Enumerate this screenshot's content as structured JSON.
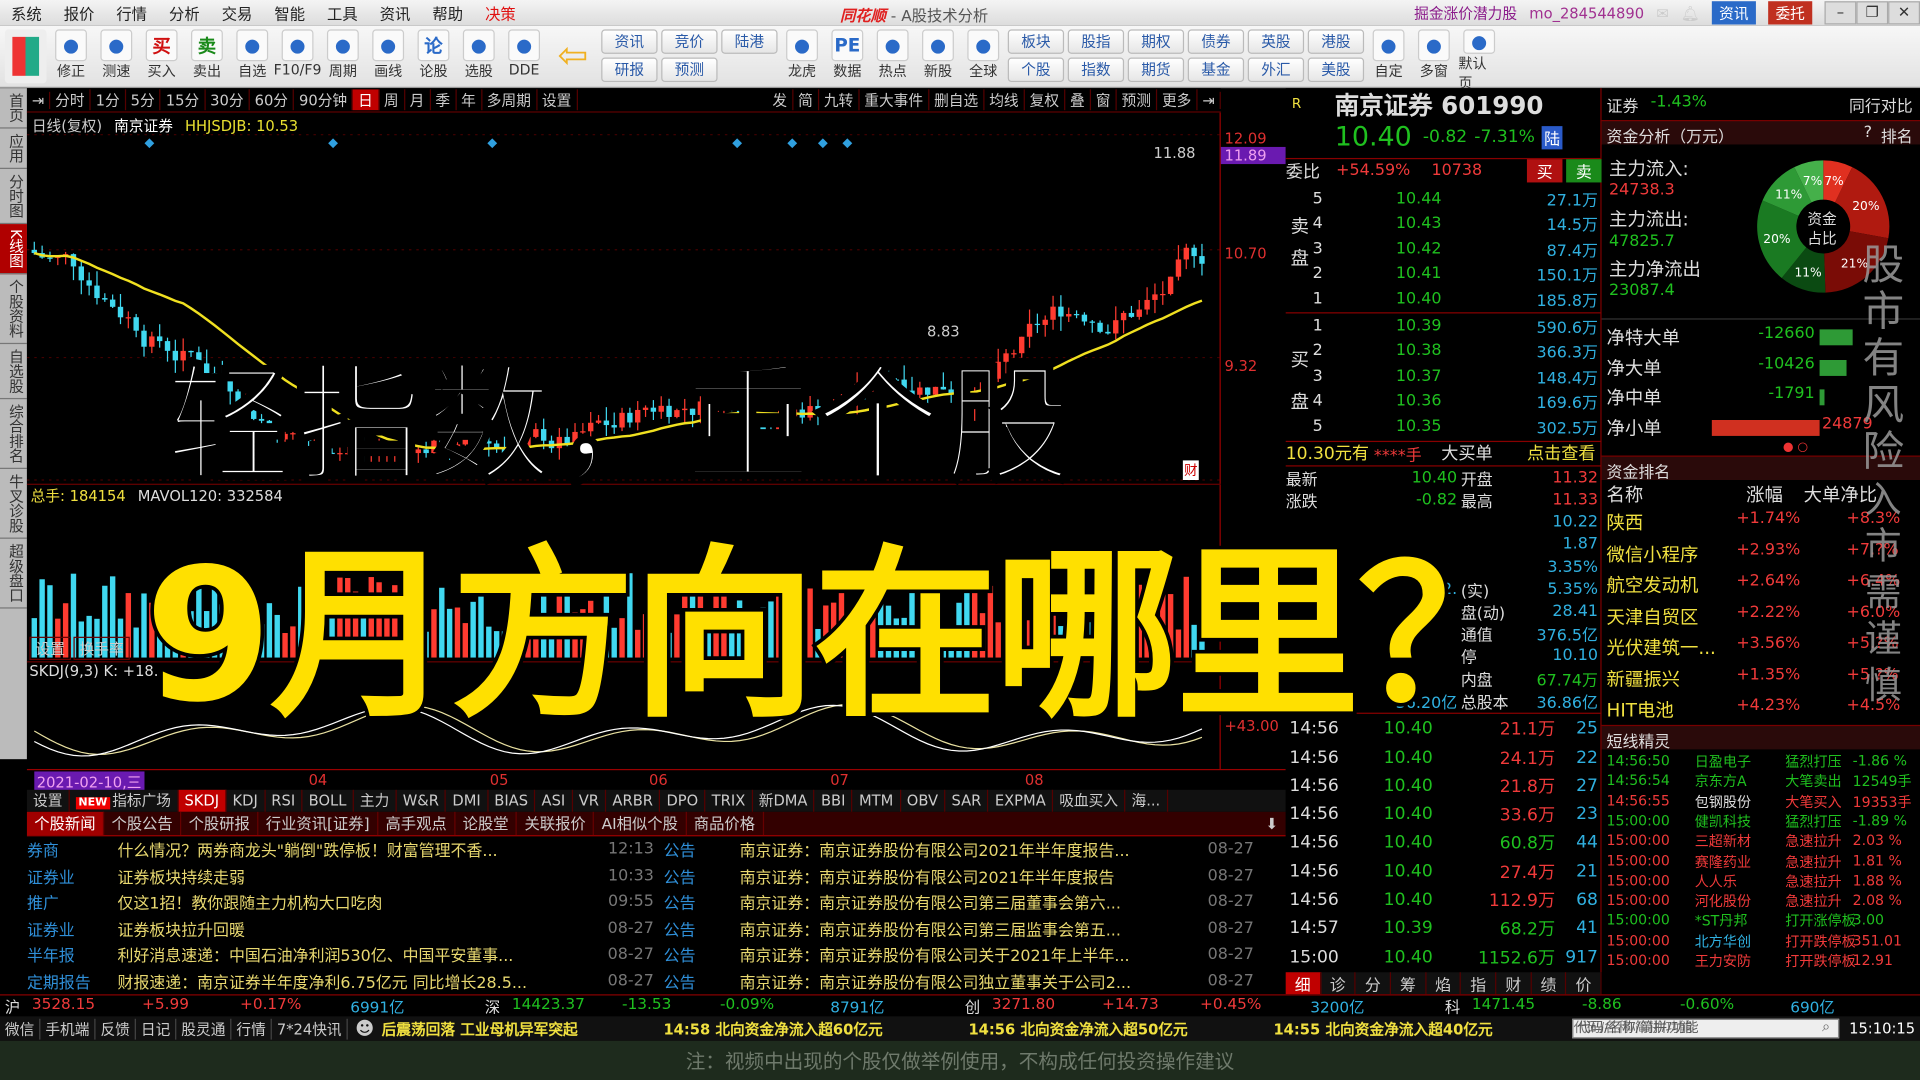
{
  "menu": [
    "系统",
    "报价",
    "行情",
    "分析",
    "交易",
    "智能",
    "工具",
    "资讯",
    "帮助",
    "决策"
  ],
  "app_title": {
    "brand": "同花顺",
    "subtitle": " - A股技术分析"
  },
  "top_right": {
    "promo": "掘金涨价潜力股",
    "user": "mo_284544890",
    "zixun": "资讯",
    "weituo": "委托"
  },
  "toolbar": {
    "tools": [
      {
        "label": "修正",
        "icon": "arrow-up-down-icon"
      },
      {
        "label": "测速",
        "icon": "clock-icon"
      },
      {
        "label": "买入",
        "icon": "buy-icon",
        "glyph": "买"
      },
      {
        "label": "卖出",
        "icon": "sell-icon",
        "glyph": "卖"
      },
      {
        "label": "自选",
        "icon": "star-folder-icon"
      },
      {
        "label": "F10/F9",
        "icon": "f10-icon"
      },
      {
        "label": "周期",
        "icon": "period-icon"
      },
      {
        "label": "画线",
        "icon": "pen-icon"
      },
      {
        "label": "论股",
        "icon": "lun-icon",
        "glyph": "论"
      },
      {
        "label": "选股",
        "icon": "select-stock-icon"
      },
      {
        "label": "DDE",
        "icon": "dde-icon"
      }
    ],
    "pairs1": [
      [
        "资讯",
        "研报"
      ],
      [
        "竞价",
        "预测"
      ],
      [
        "陆港",
        ""
      ]
    ],
    "tools2": [
      {
        "label": "龙虎",
        "icon": "dragon-icon"
      },
      {
        "label": "数据",
        "icon": "pe-icon",
        "glyph": "PE"
      },
      {
        "label": "热点",
        "icon": "hot-icon"
      },
      {
        "label": "新股",
        "icon": "ipo-icon"
      },
      {
        "label": "全球",
        "icon": "globe-icon"
      }
    ],
    "pairs2": [
      [
        "板块",
        "个股"
      ],
      [
        "股指",
        "指数"
      ],
      [
        "期权",
        "期货"
      ],
      [
        "债券",
        "基金"
      ],
      [
        "英股",
        "外汇"
      ],
      [
        "港股",
        "美股"
      ]
    ],
    "tools3": [
      {
        "label": "自定",
        "icon": "custom-icon"
      },
      {
        "label": "多窗",
        "icon": "multiwindow-icon"
      },
      {
        "label": "默认页",
        "icon": "default-page-icon"
      }
    ]
  },
  "left_tabs": [
    "首页",
    "应用",
    "分时图",
    "K线图",
    "个股资料",
    "自选股",
    "综合排名",
    "牛叉诊股",
    "超级盘口"
  ],
  "period_bar": [
    "分时",
    "1分",
    "5分",
    "15分",
    "30分",
    "60分",
    "90分钟",
    "日",
    "周",
    "月",
    "季",
    "年",
    "多周期",
    "设置"
  ],
  "period_active": "日",
  "chart_tools": [
    "发",
    "简",
    "九转",
    "重大事件",
    "删自选",
    "均线",
    "复权",
    "叠",
    "窗",
    "预测",
    "更多"
  ],
  "chart": {
    "header_type": "日线(复权)",
    "header_name": "南京证券",
    "indicator": "HHJSDJB: 10.53",
    "high_label": "11.88",
    "low_label": "8.83",
    "vol_header": "总手: 184154",
    "mavol": "MAVOL120: 332584",
    "skdj_header": "SKDJ(9,3) K: +18.",
    "vol_buttons": [
      "设置",
      "换手率"
    ],
    "fin_marker": "财"
  },
  "price_axis": [
    "12.09",
    "11.89",
    "10.70",
    "9.32",
    "+43.00"
  ],
  "date_axis": {
    "current": "2021-02-10,三",
    "months": [
      "04",
      "05",
      "06",
      "07",
      "08"
    ]
  },
  "indicator_tabs": [
    "设置",
    "指标广场",
    "SKDJ",
    "KDJ",
    "RSI",
    "BOLL",
    "主力",
    "W&R",
    "DMI",
    "BIAS",
    "ASI",
    "VR",
    "ARBR",
    "DPO",
    "TRIX",
    "新DMA",
    "BBI",
    "MTM",
    "OBV",
    "SAR",
    "EXPMA",
    "吸血买入",
    "海..."
  ],
  "news_tabs": [
    "个股新闻",
    "个股公告",
    "个股研报",
    "行业资讯[证券]",
    "高手观点",
    "论股堂",
    "关联报价",
    "AI相似个股",
    "商品价格"
  ],
  "news": [
    {
      "tag": "券商",
      "title": "什么情况？两券商龙头\"躺倒\"跌停板！财富管理不香...",
      "time": "12:13",
      "tag2": "公告",
      "title2": "南京证券：南京证券股份有限公司2021年半年度报告...",
      "date2": "08-27"
    },
    {
      "tag": "证券业",
      "title": "证券板块持续走弱",
      "time": "10:33",
      "tag2": "公告",
      "title2": "南京证券：南京证券股份有限公司2021年半年度报告",
      "date2": "08-27"
    },
    {
      "tag": "推广",
      "title": "仅这1招！教你跟随主力机构大口吃肉",
      "time": "09:55",
      "tag2": "公告",
      "title2": "南京证券：南京证券股份有限公司第三届董事会第六...",
      "date2": "08-27"
    },
    {
      "tag": "证券业",
      "title": "证券板块拉升回暖",
      "time": "08-27",
      "tag2": "公告",
      "title2": "南京证券：南京证券股份有限公司第三届监事会第五...",
      "date2": "08-27"
    },
    {
      "tag": "半年报",
      "title": "利好消息速递：中国石油净利润530亿、中国平安董事...",
      "time": "08-27",
      "tag2": "公告",
      "title2": "南京证券：南京证券股份有限公司关于2021年上半年...",
      "date2": "08-27"
    },
    {
      "tag": "定期报告",
      "title": "财报速递：南京证券半年度净利6.75亿元 同比增长28.5...",
      "time": "08-27",
      "tag2": "公告",
      "title2": "南京证券：南京证券股份有限公司独立董事关于公司2...",
      "date2": "08-27"
    }
  ],
  "quote": {
    "r": "R",
    "name": "南京证券 601990",
    "price": "10.40",
    "change": "-0.82",
    "pct": "-7.31%",
    "market": "陆",
    "weibi_label": "委比",
    "weibi": "+54.59%",
    "weicha": "10738",
    "buy": "买",
    "sell": "卖",
    "sell_label": "卖盘",
    "buy_label": "买盘",
    "asks": [
      [
        "5",
        "10.44",
        "27.1万"
      ],
      [
        "4",
        "10.43",
        "14.5万"
      ],
      [
        "3",
        "10.42",
        "87.4万"
      ],
      [
        "2",
        "10.41",
        "150.1万"
      ],
      [
        "1",
        "10.40",
        "185.8万"
      ]
    ],
    "bids": [
      [
        "1",
        "10.39",
        "590.6万"
      ],
      [
        "2",
        "10.38",
        "366.3万"
      ],
      [
        "3",
        "10.37",
        "148.4万"
      ],
      [
        "4",
        "10.36",
        "169.6万"
      ],
      [
        "5",
        "10.35",
        "302.5万"
      ]
    ],
    "bigorder": {
      "price": "10.30元有",
      "qty": "****手",
      "label": "大买单",
      "link": "点击查看"
    },
    "stats": [
      [
        "最新",
        "10.40",
        "开盘",
        "11.32"
      ],
      [
        "涨跌",
        "-0.82",
        "最高",
        "11.33"
      ],
      [
        "",
        "",
        "",
        "10.22"
      ],
      [
        "",
        "",
        "",
        "1.87"
      ],
      [
        "",
        "",
        "",
        "3.35%"
      ],
      [
        "",
        "2.",
        "(实)",
        "5.35%"
      ],
      [
        "",
        "",
        "盘(动)",
        "28.41"
      ],
      [
        "",
        "",
        "通值",
        "376.5亿"
      ],
      [
        "",
        "",
        "停",
        "10.10"
      ],
      [
        "",
        "",
        "内盘",
        "67.74万"
      ],
      [
        "流通股",
        "36.20亿",
        "总股本",
        "36.86亿"
      ]
    ],
    "ticks": [
      [
        "14:56",
        "10.40",
        "21.1万",
        "25",
        "red"
      ],
      [
        "14:56",
        "10.40",
        "24.1万",
        "22",
        "red"
      ],
      [
        "14:56",
        "10.40",
        "21.8万",
        "27",
        "red"
      ],
      [
        "14:56",
        "10.40",
        "33.6万",
        "23",
        "red"
      ],
      [
        "14:56",
        "10.40",
        "60.8万",
        "44",
        "green"
      ],
      [
        "14:56",
        "10.40",
        "27.4万",
        "21",
        "red"
      ],
      [
        "14:56",
        "10.40",
        "112.9万",
        "68",
        "red"
      ],
      [
        "14:57",
        "10.39",
        "68.2万",
        "41",
        "green"
      ],
      [
        "15:00",
        "10.40",
        "1152.6万",
        "917",
        "green"
      ]
    ],
    "bottom_tabs": [
      "细",
      "诊",
      "分",
      "筹",
      "焰",
      "指",
      "财",
      "绩",
      "价"
    ]
  },
  "fund": {
    "sector": "证券",
    "sector_pct": "-1.43%",
    "compare": "同行对比",
    "title": "资金分析（万元）",
    "help": "?",
    "rank": "排名",
    "inflow_label": "主力流入:",
    "inflow": "24738.3",
    "outflow_label": "主力流出:",
    "outflow": "47825.7",
    "net_label": "主力净流出",
    "net": "23087.4",
    "donut_center": [
      "资金",
      "占比"
    ],
    "donut": [
      {
        "pct": 7,
        "color": "#e03020"
      },
      {
        "pct": 20,
        "color": "#b01a10"
      },
      {
        "pct": 21,
        "color": "#7a0c06"
      },
      {
        "pct": 11,
        "color": "#0b4a12"
      },
      {
        "pct": 20,
        "color": "#1a7a22"
      },
      {
        "pct": 11,
        "color": "#2e9a36"
      },
      {
        "pct": 7,
        "color": "#45b04a"
      }
    ],
    "flows": [
      {
        "label": "净特大单",
        "value": "-12660",
        "v": -12660
      },
      {
        "label": "净大单",
        "value": "-10426",
        "v": -10426
      },
      {
        "label": "净中单",
        "value": "-1791",
        "v": -1791
      },
      {
        "label": "净小单",
        "value": "24879",
        "v": 24879
      }
    ],
    "rank_title": "资金排名",
    "rank_headers": [
      "名称",
      "涨幅",
      "大单净比"
    ],
    "ranks": [
      [
        "陕西",
        "+1.74%",
        "+8.3%"
      ],
      [
        "微信小程序",
        "+2.93%",
        "+7.?%"
      ],
      [
        "航空发动机",
        "+2.64%",
        "+6.4%"
      ],
      [
        "天津自贸区",
        "+2.22%",
        "+6.0%"
      ],
      [
        "光伏建筑一...",
        "+3.56%",
        "+5.?%"
      ],
      [
        "新疆振兴",
        "+1.35%",
        "+5.?%"
      ],
      [
        "HIT电池",
        "+4.23%",
        "+4.5%"
      ]
    ],
    "sprite_title": "短线精灵",
    "sprites": [
      [
        "14:56:50",
        "日盈电子",
        "猛烈打压",
        "-1.86 %",
        "green"
      ],
      [
        "14:56:54",
        "京东方A",
        "大笔卖出",
        "12549手",
        "green"
      ],
      [
        "14:56:55",
        "包钢股份",
        "大笔买入",
        "19353手",
        "red"
      ],
      [
        "15:00:00",
        "健凯科技",
        "猛烈打压",
        "-1.89 %",
        "green"
      ],
      [
        "15:00:00",
        "三超新材",
        "急速拉升",
        "2.03 %",
        "red"
      ],
      [
        "15:00:00",
        "赛隆药业",
        "急速拉升",
        "1.81 %",
        "red"
      ],
      [
        "15:00:00",
        "人人乐",
        "急速拉升",
        "1.88 %",
        "red"
      ],
      [
        "15:00:00",
        "河化股份",
        "急速拉升",
        "2.08 %",
        "red"
      ],
      [
        "15:00:00",
        "*ST丹邦",
        "打开涨停板",
        "3.00",
        "green"
      ],
      [
        "15:00:00",
        "北方华创",
        "打开跌停板",
        "351.01",
        "red"
      ],
      [
        "15:00:00",
        "王力安防",
        "打开跌停板",
        "12.91",
        "red"
      ]
    ]
  },
  "indices": [
    {
      "name": "沪",
      "val": "3528.15",
      "chg": "+5.99",
      "pct": "+0.17%",
      "amt": "6991亿",
      "c": "red"
    },
    {
      "name": "深",
      "val": "14423.37",
      "chg": "-13.53",
      "pct": "-0.09%",
      "amt": "8791亿",
      "c": "green"
    },
    {
      "name": "创",
      "val": "3271.80",
      "chg": "+14.73",
      "pct": "+0.45%",
      "amt": "3200亿",
      "c": "red"
    },
    {
      "name": "科",
      "val": "1471.45",
      "chg": "-8.86",
      "pct": "-0.60%",
      "amt": "690亿",
      "c": "green"
    }
  ],
  "statusbar": {
    "items": [
      "微信",
      "手机端",
      "反馈",
      "日记",
      "股灵通",
      "行情",
      "7*24快讯"
    ],
    "ticker": [
      "后震荡回落 工业母机异军突起",
      "14:58 北向资金净流入超60亿元",
      "14:56 北向资金净流入超50亿元",
      "14:55 北向资金净流入超40亿元"
    ],
    "search_placeholder": "代码/名称/简拼/功能",
    "clock": "15:10:15"
  },
  "overlay": {
    "line1": "轻指数，重个股",
    "line2": "9月方向在哪里？",
    "warning": "股市有风险",
    "warning2": "入市需谨慎"
  },
  "disclaimer": "注：视频中出现的个股仅做举例使用，不构成任何投资操作建议"
}
